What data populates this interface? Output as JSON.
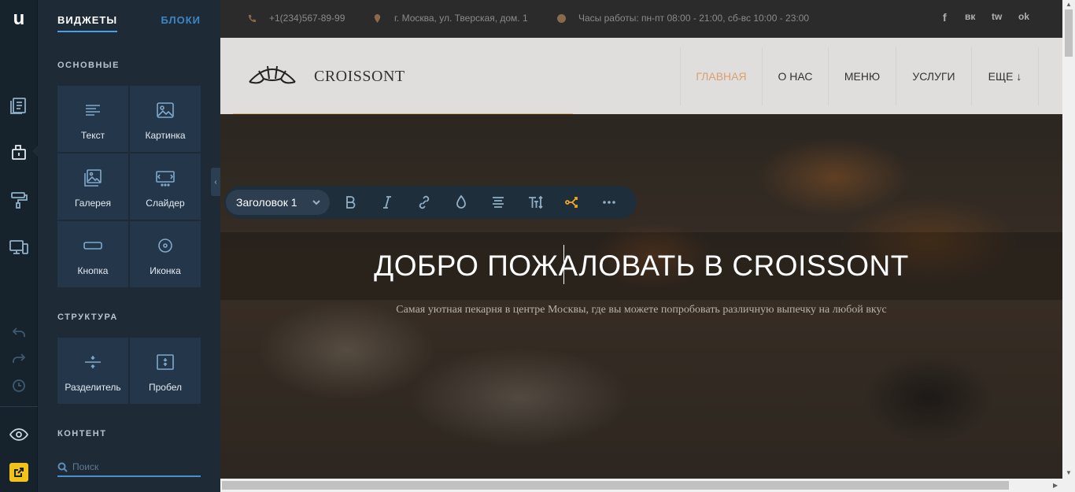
{
  "rail": {
    "logo": "u"
  },
  "panel": {
    "tabs": [
      "ВИДЖЕТЫ",
      "БЛОКИ"
    ],
    "sections": {
      "basic": "ОСНОВНЫЕ",
      "structure": "СТРУКТУРА",
      "content": "КОНТЕНТ"
    },
    "widgets": [
      {
        "label": "Текст",
        "icon": "text-icon"
      },
      {
        "label": "Картинка",
        "icon": "image-icon"
      },
      {
        "label": "Галерея",
        "icon": "gallery-icon"
      },
      {
        "label": "Слайдер",
        "icon": "slider-icon"
      },
      {
        "label": "Кнопка",
        "icon": "button-icon"
      },
      {
        "label": "Иконка",
        "icon": "icon-icon"
      }
    ],
    "structure": [
      {
        "label": "Разделитель",
        "icon": "divider-icon"
      },
      {
        "label": "Пробел",
        "icon": "spacer-icon"
      }
    ],
    "search_placeholder": "Поиск"
  },
  "site": {
    "topbar": {
      "phone": "+1(234)567-89-99",
      "address": "г. Москва, ул. Тверская, дом. 1",
      "hours": "Часы работы: пн-пт 08:00 - 21:00, сб-вс 10:00 - 23:00",
      "social": [
        "f",
        "вк",
        "tw",
        "ok"
      ]
    },
    "header": {
      "brand": "CROISSONT",
      "nav": [
        "ГЛАВНАЯ",
        "О НАС",
        "МЕНЮ",
        "УСЛУГИ",
        "ЕЩЕ ↓"
      ]
    },
    "hero": {
      "title": "ДОБРО ПОЖАЛОВАТЬ В CROISSONT",
      "subtitle": "Самая уютная пекарня в центре Москвы, где вы можете попробовать различную выпечку на любой вкус"
    },
    "toolbar": {
      "style_select": "Заголовок 1"
    }
  },
  "colors": {
    "accent": "#4aa0e6",
    "nav_active": "#d7a170",
    "highlight": "#f0a820"
  }
}
